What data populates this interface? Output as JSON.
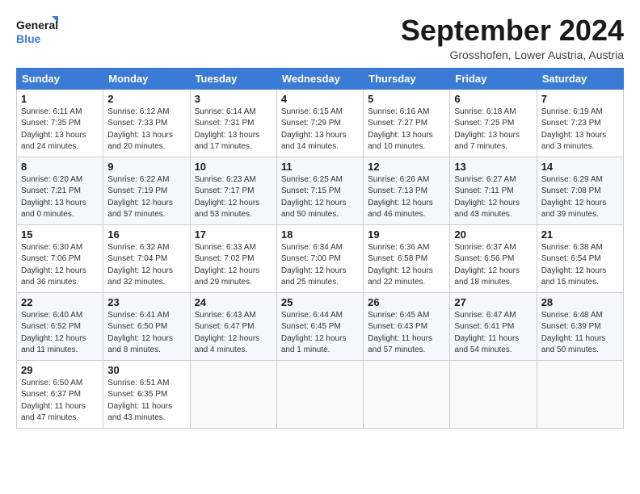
{
  "logo": {
    "line1": "General",
    "line2": "Blue"
  },
  "title": "September 2024",
  "subtitle": "Grosshofen, Lower Austria, Austria",
  "weekdays": [
    "Sunday",
    "Monday",
    "Tuesday",
    "Wednesday",
    "Thursday",
    "Friday",
    "Saturday"
  ],
  "weeks": [
    [
      {
        "day": "1",
        "info": "Sunrise: 6:11 AM\nSunset: 7:35 PM\nDaylight: 13 hours\nand 24 minutes."
      },
      {
        "day": "2",
        "info": "Sunrise: 6:12 AM\nSunset: 7:33 PM\nDaylight: 13 hours\nand 20 minutes."
      },
      {
        "day": "3",
        "info": "Sunrise: 6:14 AM\nSunset: 7:31 PM\nDaylight: 13 hours\nand 17 minutes."
      },
      {
        "day": "4",
        "info": "Sunrise: 6:15 AM\nSunset: 7:29 PM\nDaylight: 13 hours\nand 14 minutes."
      },
      {
        "day": "5",
        "info": "Sunrise: 6:16 AM\nSunset: 7:27 PM\nDaylight: 13 hours\nand 10 minutes."
      },
      {
        "day": "6",
        "info": "Sunrise: 6:18 AM\nSunset: 7:25 PM\nDaylight: 13 hours\nand 7 minutes."
      },
      {
        "day": "7",
        "info": "Sunrise: 6:19 AM\nSunset: 7:23 PM\nDaylight: 13 hours\nand 3 minutes."
      }
    ],
    [
      {
        "day": "8",
        "info": "Sunrise: 6:20 AM\nSunset: 7:21 PM\nDaylight: 13 hours\nand 0 minutes."
      },
      {
        "day": "9",
        "info": "Sunrise: 6:22 AM\nSunset: 7:19 PM\nDaylight: 12 hours\nand 57 minutes."
      },
      {
        "day": "10",
        "info": "Sunrise: 6:23 AM\nSunset: 7:17 PM\nDaylight: 12 hours\nand 53 minutes."
      },
      {
        "day": "11",
        "info": "Sunrise: 6:25 AM\nSunset: 7:15 PM\nDaylight: 12 hours\nand 50 minutes."
      },
      {
        "day": "12",
        "info": "Sunrise: 6:26 AM\nSunset: 7:13 PM\nDaylight: 12 hours\nand 46 minutes."
      },
      {
        "day": "13",
        "info": "Sunrise: 6:27 AM\nSunset: 7:11 PM\nDaylight: 12 hours\nand 43 minutes."
      },
      {
        "day": "14",
        "info": "Sunrise: 6:29 AM\nSunset: 7:08 PM\nDaylight: 12 hours\nand 39 minutes."
      }
    ],
    [
      {
        "day": "15",
        "info": "Sunrise: 6:30 AM\nSunset: 7:06 PM\nDaylight: 12 hours\nand 36 minutes."
      },
      {
        "day": "16",
        "info": "Sunrise: 6:32 AM\nSunset: 7:04 PM\nDaylight: 12 hours\nand 32 minutes."
      },
      {
        "day": "17",
        "info": "Sunrise: 6:33 AM\nSunset: 7:02 PM\nDaylight: 12 hours\nand 29 minutes."
      },
      {
        "day": "18",
        "info": "Sunrise: 6:34 AM\nSunset: 7:00 PM\nDaylight: 12 hours\nand 25 minutes."
      },
      {
        "day": "19",
        "info": "Sunrise: 6:36 AM\nSunset: 6:58 PM\nDaylight: 12 hours\nand 22 minutes."
      },
      {
        "day": "20",
        "info": "Sunrise: 6:37 AM\nSunset: 6:56 PM\nDaylight: 12 hours\nand 18 minutes."
      },
      {
        "day": "21",
        "info": "Sunrise: 6:38 AM\nSunset: 6:54 PM\nDaylight: 12 hours\nand 15 minutes."
      }
    ],
    [
      {
        "day": "22",
        "info": "Sunrise: 6:40 AM\nSunset: 6:52 PM\nDaylight: 12 hours\nand 11 minutes."
      },
      {
        "day": "23",
        "info": "Sunrise: 6:41 AM\nSunset: 6:50 PM\nDaylight: 12 hours\nand 8 minutes."
      },
      {
        "day": "24",
        "info": "Sunrise: 6:43 AM\nSunset: 6:47 PM\nDaylight: 12 hours\nand 4 minutes."
      },
      {
        "day": "25",
        "info": "Sunrise: 6:44 AM\nSunset: 6:45 PM\nDaylight: 12 hours\nand 1 minute."
      },
      {
        "day": "26",
        "info": "Sunrise: 6:45 AM\nSunset: 6:43 PM\nDaylight: 11 hours\nand 57 minutes."
      },
      {
        "day": "27",
        "info": "Sunrise: 6:47 AM\nSunset: 6:41 PM\nDaylight: 11 hours\nand 54 minutes."
      },
      {
        "day": "28",
        "info": "Sunrise: 6:48 AM\nSunset: 6:39 PM\nDaylight: 11 hours\nand 50 minutes."
      }
    ],
    [
      {
        "day": "29",
        "info": "Sunrise: 6:50 AM\nSunset: 6:37 PM\nDaylight: 11 hours\nand 47 minutes."
      },
      {
        "day": "30",
        "info": "Sunrise: 6:51 AM\nSunset: 6:35 PM\nDaylight: 11 hours\nand 43 minutes."
      },
      {
        "day": "",
        "info": ""
      },
      {
        "day": "",
        "info": ""
      },
      {
        "day": "",
        "info": ""
      },
      {
        "day": "",
        "info": ""
      },
      {
        "day": "",
        "info": ""
      }
    ]
  ]
}
